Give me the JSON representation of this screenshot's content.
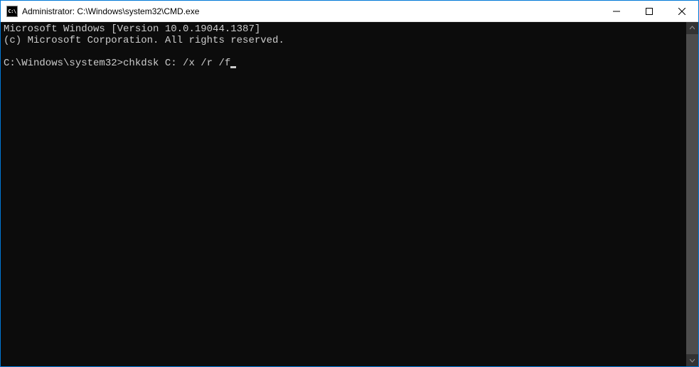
{
  "titlebar": {
    "icon_label": "C:\\",
    "title": "Administrator: C:\\Windows\\system32\\CMD.exe"
  },
  "console": {
    "line1": "Microsoft Windows [Version 10.0.19044.1387]",
    "line2": "(c) Microsoft Corporation. All rights reserved.",
    "blank": "",
    "prompt": "C:\\Windows\\system32>",
    "command": "chkdsk C: /x /r /f"
  }
}
